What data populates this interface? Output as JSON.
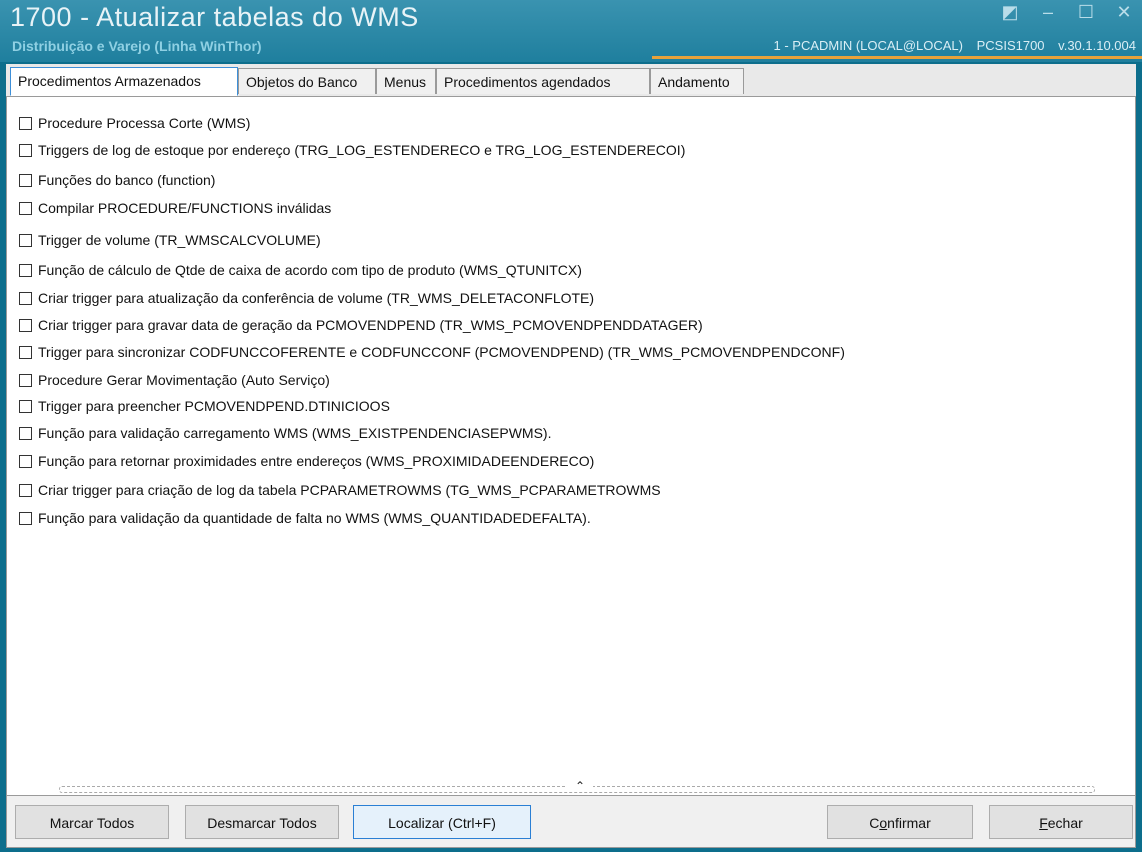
{
  "window": {
    "title": "1700 - Atualizar tabelas do WMS",
    "subtitle": "Distribuição e Varejo (Linha WinThor)",
    "user": "1 - PCADMIN (LOCAL@LOCAL)",
    "program": "PCSIS1700",
    "version": "v.30.1.10.004"
  },
  "tabs": [
    {
      "label": "Procedimentos Armazenados",
      "active": true
    },
    {
      "label": "Objetos do Banco",
      "active": false
    },
    {
      "label": "Menus",
      "active": false
    },
    {
      "label": "Procedimentos agendados",
      "active": false
    },
    {
      "label": "Andamento",
      "active": false
    }
  ],
  "items": [
    {
      "label": "Procedure Processa Corte (WMS)",
      "checked": false
    },
    {
      "label": "Triggers de log de estoque por endereço (TRG_LOG_ESTENDERECO e TRG_LOG_ESTENDERECOI)",
      "checked": false
    },
    {
      "label": "Funções do banco (function)",
      "checked": false
    },
    {
      "label": "Compilar PROCEDURE/FUNCTIONS inválidas",
      "checked": false
    },
    {
      "label": "Trigger de volume (TR_WMSCALCVOLUME)",
      "checked": false
    },
    {
      "label": "Função de cálculo de Qtde de caixa de acordo com tipo de produto (WMS_QTUNITCX)",
      "checked": false
    },
    {
      "label": "Criar trigger para atualização da conferência de volume (TR_WMS_DELETACONFLOTE)",
      "checked": false
    },
    {
      "label": "Criar trigger para gravar data de geração da PCMOVENDPEND (TR_WMS_PCMOVENDPENDDATAGER)",
      "checked": false
    },
    {
      "label": "Trigger para sincronizar CODFUNCCOFERENTE e CODFUNCCONF (PCMOVENDPEND) (TR_WMS_PCMOVENDPENDCONF)",
      "checked": false
    },
    {
      "label": "Procedure Gerar Movimentação (Auto Serviço)",
      "checked": false
    },
    {
      "label": "Trigger para preencher PCMOVENDPEND.DTINICIOOS",
      "checked": false
    },
    {
      "label": "Função para validação carregamento WMS (WMS_EXISTPENDENCIASEPWMS).",
      "checked": false
    },
    {
      "label": "Função para retornar proximidades entre endereços (WMS_PROXIMIDADEENDERECO)",
      "checked": false
    },
    {
      "label": "Criar trigger para criação de log da tabela PCPARAMETROWMS (TG_WMS_PCPARAMETROWMS",
      "checked": false
    },
    {
      "label": "Função para validação da quantidade de falta no WMS (WMS_QUANTIDADEDEFALTA).",
      "checked": false
    }
  ],
  "buttons": {
    "mark_all": "Marcar Todos",
    "unmark_all": "Desmarcar Todos",
    "find": "Localizar (Ctrl+F)",
    "confirm_pre": "C",
    "confirm_u": "o",
    "confirm_post": "nfirmar",
    "close_u": "F",
    "close_post": "echar"
  },
  "icons": {
    "restore": "restore-icon",
    "minimize": "minimize-icon",
    "maximize": "maximize-icon",
    "close": "close-icon",
    "scroll": "chevron-up-icon"
  }
}
